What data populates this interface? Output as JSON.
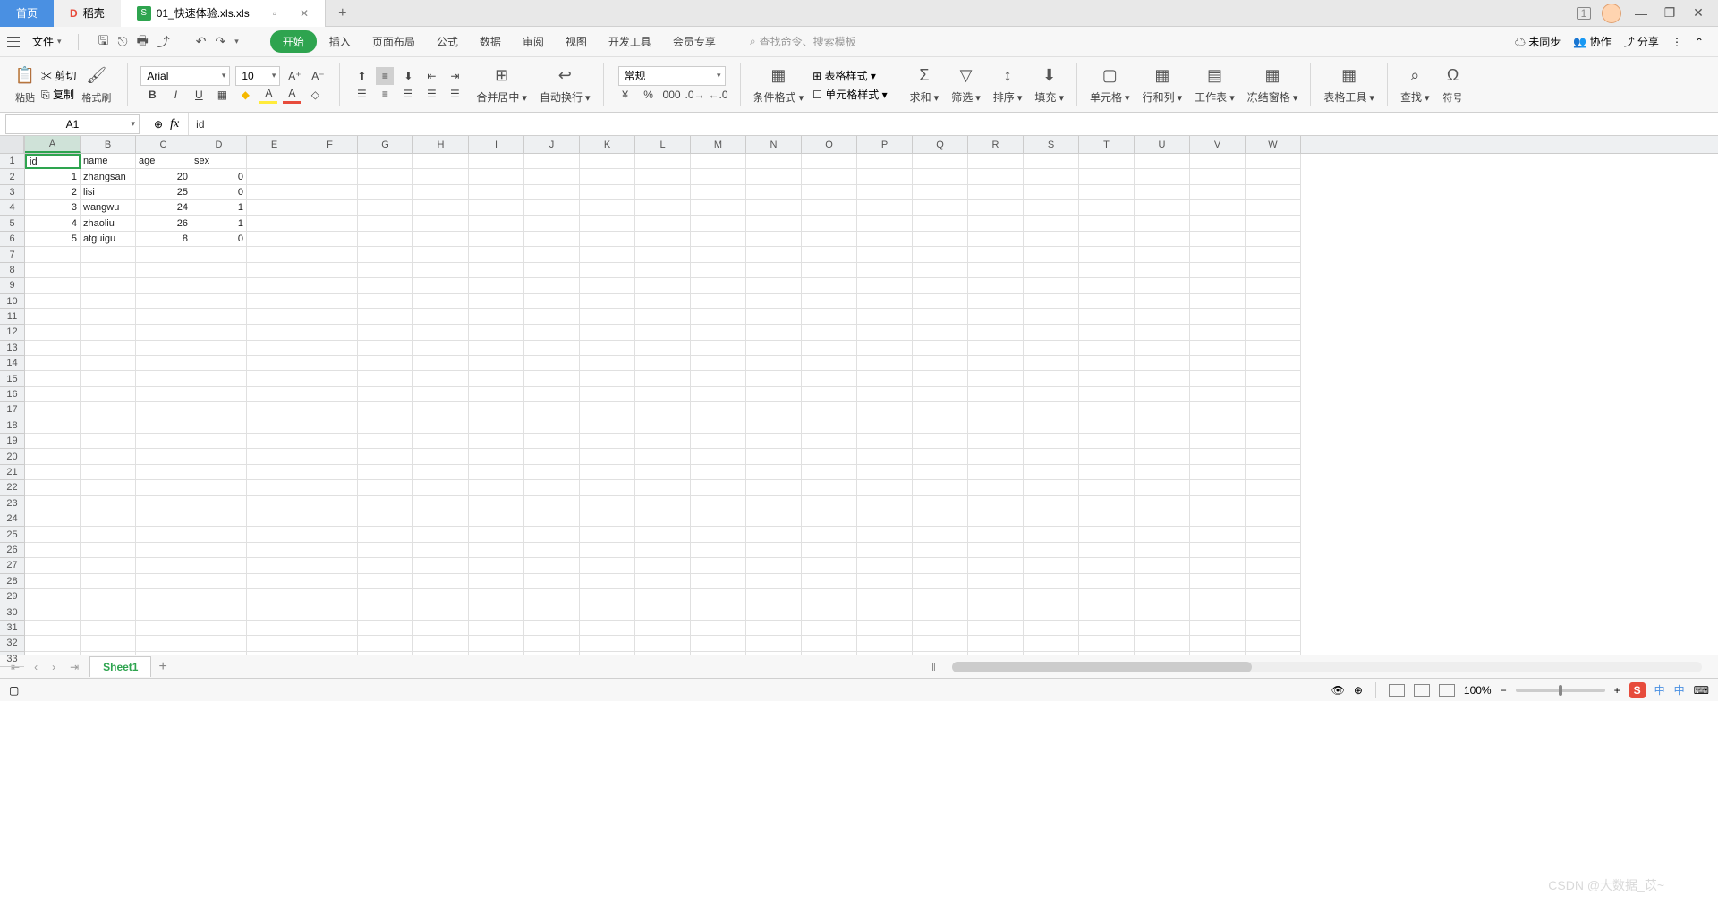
{
  "titlebar": {
    "home_tab": "首页",
    "docer_tab": "稻壳",
    "file_tab": "01_快速体验.xls.xls",
    "box_badge": "1"
  },
  "menubar": {
    "file": "文件",
    "tabs": [
      "开始",
      "插入",
      "页面布局",
      "公式",
      "数据",
      "审阅",
      "视图",
      "开发工具",
      "会员专享"
    ],
    "search_placeholder": "查找命令、搜索模板",
    "sync": "未同步",
    "coop": "协作",
    "share": "分享"
  },
  "ribbon": {
    "paste": "粘贴",
    "cut": "剪切",
    "copy": "复制",
    "format_painter": "格式刷",
    "font_name": "Arial",
    "font_size": "10",
    "merge": "合并居中",
    "wrap": "自动换行",
    "number_format": "常规",
    "cond_fmt": "条件格式",
    "table_style": "表格样式",
    "cell_style": "单元格样式",
    "sum": "求和",
    "filter": "筛选",
    "sort": "排序",
    "fill": "填充",
    "cell": "单元格",
    "rowcol": "行和列",
    "worksheet": "工作表",
    "freeze": "冻结窗格",
    "tabletool": "表格工具",
    "find": "查找",
    "symbol": "符号"
  },
  "namebox": {
    "cell_ref": "A1",
    "formula": "id"
  },
  "spreadsheet": {
    "columns": [
      "A",
      "B",
      "C",
      "D",
      "E",
      "F",
      "G",
      "H",
      "I",
      "J",
      "K",
      "L",
      "M",
      "N",
      "O",
      "P",
      "Q",
      "R",
      "S",
      "T",
      "U",
      "V",
      "W"
    ],
    "row_count": 33,
    "headers": [
      "id",
      "name",
      "age",
      "sex"
    ],
    "data": [
      {
        "id": "1",
        "name": "zhangsan",
        "age": "20",
        "sex": "0"
      },
      {
        "id": "2",
        "name": "lisi",
        "age": "25",
        "sex": "0"
      },
      {
        "id": "3",
        "name": "wangwu",
        "age": "24",
        "sex": "1"
      },
      {
        "id": "4",
        "name": "zhaoliu",
        "age": "26",
        "sex": "1"
      },
      {
        "id": "5",
        "name": "atguigu",
        "age": "8",
        "sex": "0"
      }
    ]
  },
  "sheetbar": {
    "active_sheet": "Sheet1"
  },
  "statusbar": {
    "zoom": "100%",
    "ime": "中",
    "ime2": "中",
    "watermark": "CSDN @大数据_苡~"
  }
}
